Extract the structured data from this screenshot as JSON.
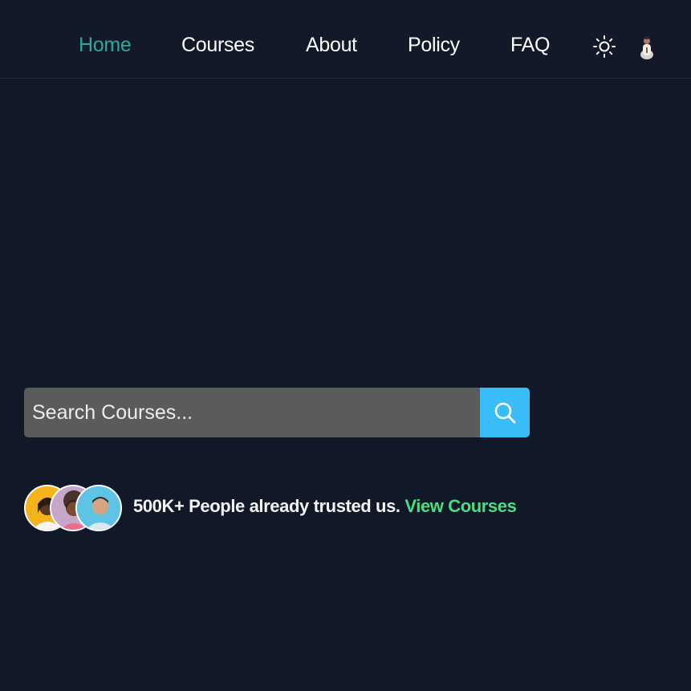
{
  "nav": {
    "links": [
      {
        "label": "Home",
        "active": true
      },
      {
        "label": "Courses",
        "active": false
      },
      {
        "label": "About",
        "active": false
      },
      {
        "label": "Policy",
        "active": false
      },
      {
        "label": "FAQ",
        "active": false
      }
    ],
    "theme_icon": "sun-icon",
    "profile_icon": "user-avatar"
  },
  "search": {
    "placeholder": "Search Courses...",
    "value": "",
    "button_icon": "search-icon"
  },
  "trust": {
    "text": "500K+ People already trusted us.",
    "link_label": "View Courses",
    "avatar_count": 3
  },
  "colors": {
    "background": "#111827",
    "active_nav": "#2fa89a",
    "search_button": "#38bdf8",
    "search_field": "#5b5b5b",
    "link_green": "#4ade80"
  }
}
